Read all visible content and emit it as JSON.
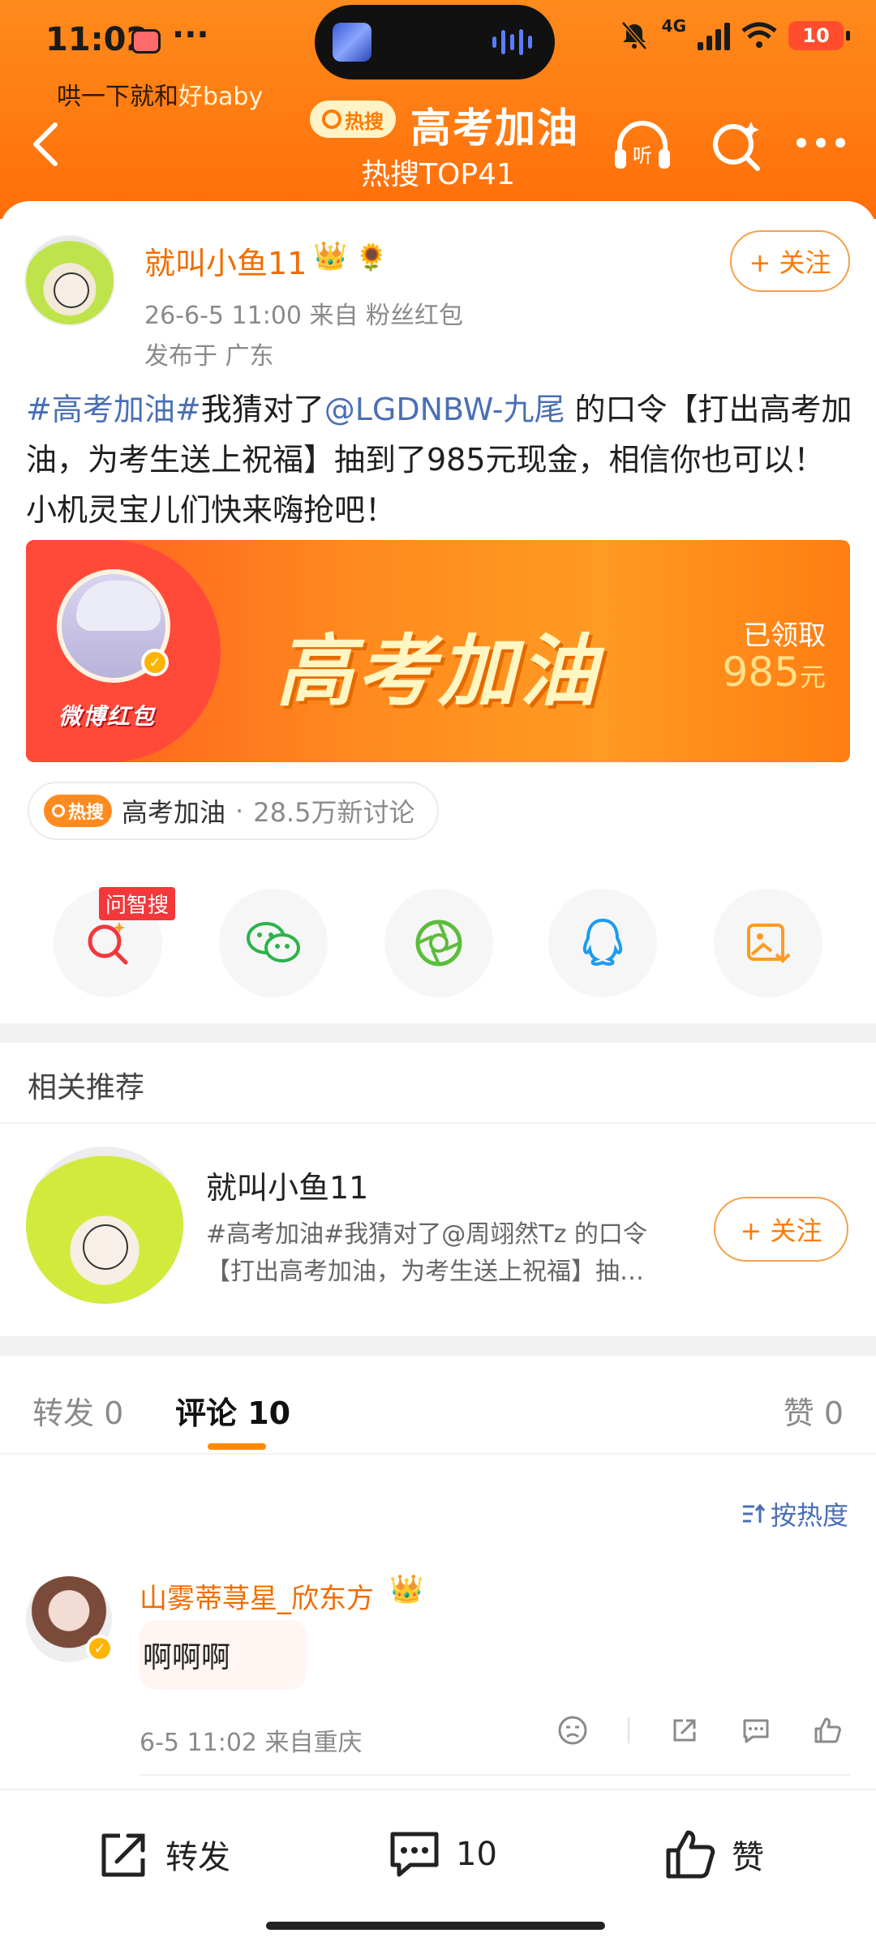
{
  "status_bar": {
    "time": "11:02",
    "dots": "···",
    "network_label": "4G",
    "battery": "10",
    "now_playing_prefix": "哄一下就和",
    "now_playing_highlight": "好baby"
  },
  "header": {
    "hot_label": "热搜",
    "title": "高考加油",
    "subtitle": "热搜TOP41",
    "icons": [
      "back-icon",
      "listen-icon",
      "search-icon",
      "more-icon"
    ],
    "listen_label": "听"
  },
  "post": {
    "author": "就叫小鱼11",
    "follow_label": "+ 关注",
    "time_source": "26-6-5 11:00   来自 粉丝红包",
    "location": "发布于 广东",
    "text_tag1": "#高考加油#",
    "text_mid": "我猜对了",
    "text_mention": "@LGDNBW-九尾",
    "text_rest": " 的口令【打出高考加油，为考生送上祝福】抽到了985元现金，相信你也可以！小机灵宝儿们快来嗨抢吧！"
  },
  "banner": {
    "brand": "微博红包",
    "slogan": "高考加油",
    "claimed_label": "已领取",
    "claimed_amount": "985",
    "currency": "元"
  },
  "topic_chip": {
    "hot_label": "热搜",
    "topic": "高考加油",
    "separator": "·",
    "discussion": "28.5万新讨论"
  },
  "share": {
    "ai_tag": "问智搜",
    "targets": [
      "ai-search-icon",
      "wechat-icon",
      "moments-icon",
      "qq-icon",
      "save-image-icon"
    ]
  },
  "recommend": {
    "title": "相关推荐",
    "name": "就叫小鱼11",
    "desc": "#高考加油#我猜对了@周翊然Tz 的口令【打出高考加油，为考生送上祝福】抽…",
    "follow_label": "+ 关注"
  },
  "tabs": {
    "repost": "转发 0",
    "comment": "评论 10",
    "like": "赞 0"
  },
  "sort_label": "按热度",
  "comment": {
    "name": "山雾蒂荨星_欣东方",
    "text": "啊啊啊",
    "meta": "6-5 11:02  来自重庆"
  },
  "bottom_bar": {
    "repost": "转发",
    "comment_count": "10",
    "like": "赞"
  },
  "colors": {
    "accent": "#ff7a00",
    "link": "#4a6fb5",
    "header_bg": "#ff7a10"
  }
}
